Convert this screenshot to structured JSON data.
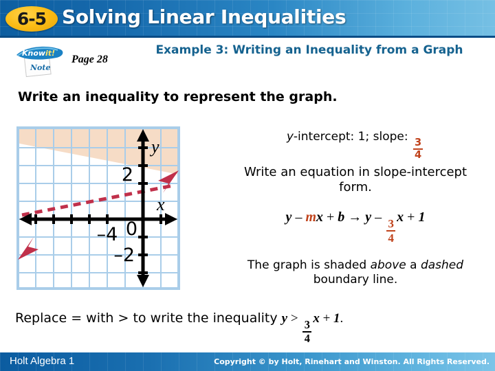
{
  "header": {
    "lesson_number": "6-5",
    "title": "Solving Linear Inequalities"
  },
  "note_logo": {
    "line1": "Know it!",
    "line2": "Note"
  },
  "page_ref": "Page 28",
  "example": {
    "title": "Example 3: Writing an Inequality from a Graph"
  },
  "prompt": "Write an inequality to represent the graph.",
  "analysis": {
    "intercept_prefix": "y",
    "intercept_text": "-intercept: 1; slope:",
    "slope_numerator": "3",
    "slope_denominator": "4",
    "instruction": "Write an equation in slope-intercept form.",
    "shade_text_1": "The graph is shaded",
    "shade_emphasis_1": "above",
    "shade_text_2": "a",
    "shade_emphasis_2": "dashed",
    "shade_text_3": "boundary line."
  },
  "equation": {
    "lhs_y": "y",
    "lhs_eq": "–",
    "lhs_m": "m",
    "lhs_x": "x",
    "lhs_plus": "+",
    "lhs_b": "b",
    "arrow": "→",
    "rhs_y": "y",
    "rhs_eq": "–",
    "rhs_num": "3",
    "rhs_den": "4",
    "rhs_x": "x",
    "rhs_plus": "+",
    "rhs_const": "1"
  },
  "conclusion": {
    "text_before": "Replace = with > to write the inequality",
    "ineq_y": "y",
    "ineq_sign": ">",
    "ineq_num": "3",
    "ineq_den": "4",
    "ineq_x": "x",
    "ineq_plus": "+",
    "ineq_const": "1",
    "period": "."
  },
  "footer": {
    "left": "Holt Algebra 1",
    "right": "Copyright © by Holt, Rinehart and Winston. All Rights Reserved."
  },
  "chart_data": {
    "type": "line",
    "title": "",
    "xlabel": "x",
    "ylabel": "y",
    "xlim": [
      -7,
      2
    ],
    "ylim": [
      -5,
      4
    ],
    "grid": true,
    "x_tick_labels": [
      {
        "value": -4,
        "label": "–4"
      }
    ],
    "y_tick_labels": [
      {
        "value": 2,
        "label": "2"
      },
      {
        "value": 0,
        "label": "0"
      },
      {
        "value": -2,
        "label": "–2"
      }
    ],
    "series": [
      {
        "name": "boundary line",
        "equation": "y = 3/4 x + 1",
        "slope": 0.75,
        "intercept": 1,
        "style": "dashed",
        "color": "#c0304a",
        "arrows": "both"
      }
    ],
    "shaded_region": {
      "relation": "y > 3/4 x + 1",
      "side": "above",
      "color": "#f6dcc6"
    },
    "colors": {
      "grid": "#a9cde9",
      "axis": "#000000",
      "border": "#a9cde9",
      "line": "#c0304a",
      "shade": "#f6dcc6"
    }
  }
}
